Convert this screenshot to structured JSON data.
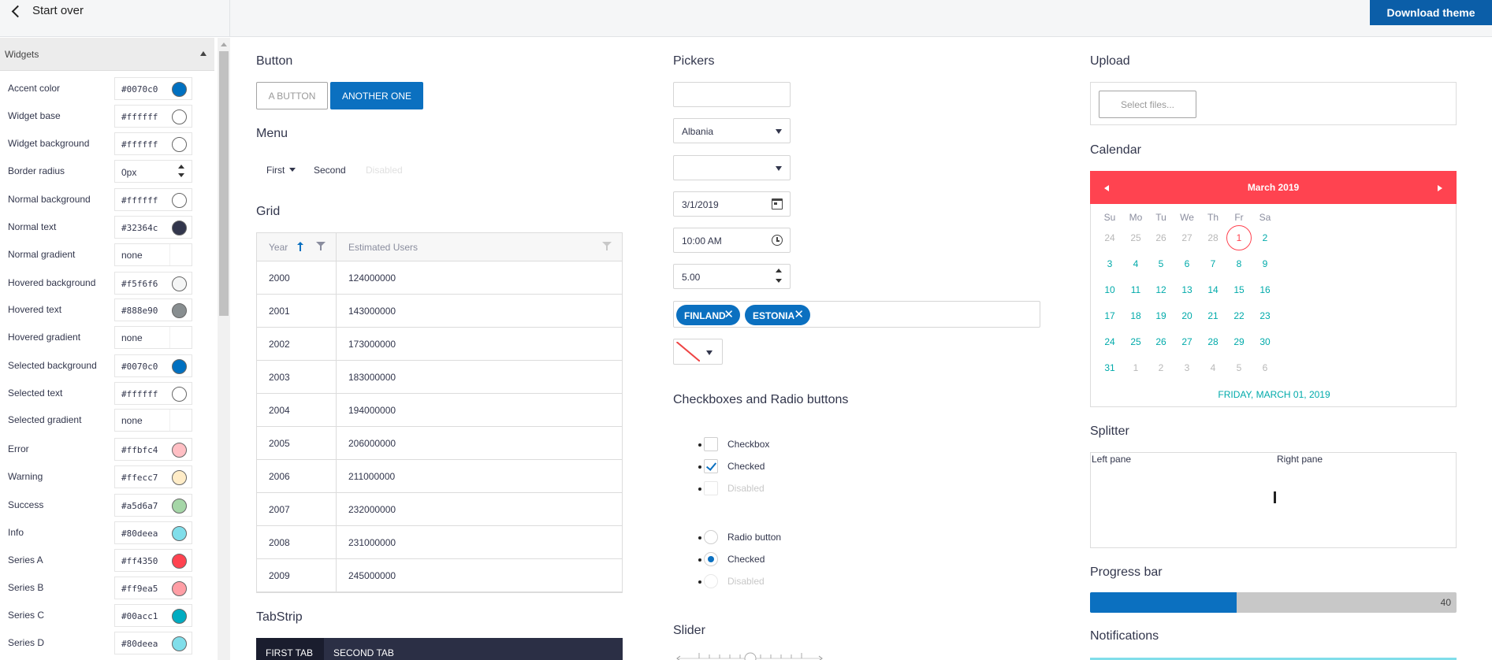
{
  "topbar": {
    "start_over": "Start over",
    "download": "Download theme"
  },
  "sidebar": {
    "section": "Widgets",
    "items": [
      {
        "label": "Accent color",
        "value": "#0070c0",
        "swatch": "#0070c0"
      },
      {
        "label": "Widget base",
        "value": "#ffffff",
        "swatch": "#ffffff"
      },
      {
        "label": "Widget background",
        "value": "#ffffff",
        "swatch": "#ffffff"
      },
      {
        "label": "Border radius",
        "value": "0px",
        "type": "number"
      },
      {
        "label": "Normal background",
        "value": "#ffffff",
        "swatch": "#ffffff"
      },
      {
        "label": "Normal text",
        "value": "#32364c",
        "swatch": "#32364c"
      },
      {
        "label": "Normal gradient",
        "value": "none",
        "type": "text"
      },
      {
        "label": "Hovered background",
        "value": "#f5f6f6",
        "swatch": "#f5f6f6"
      },
      {
        "label": "Hovered text",
        "value": "#888e90",
        "swatch": "#888e90"
      },
      {
        "label": "Hovered gradient",
        "value": "none",
        "type": "text"
      },
      {
        "label": "Selected background",
        "value": "#0070c0",
        "swatch": "#0070c0"
      },
      {
        "label": "Selected text",
        "value": "#ffffff",
        "swatch": "#ffffff"
      },
      {
        "label": "Selected gradient",
        "value": "none",
        "type": "text"
      },
      {
        "label": "Error",
        "value": "#ffbfc4",
        "swatch": "#ffbfc4"
      },
      {
        "label": "Warning",
        "value": "#ffecc7",
        "swatch": "#ffecc7"
      },
      {
        "label": "Success",
        "value": "#a5d6a7",
        "swatch": "#a5d6a7"
      },
      {
        "label": "Info",
        "value": "#80deea",
        "swatch": "#80deea"
      },
      {
        "label": "Series A",
        "value": "#ff4350",
        "swatch": "#ff4350"
      },
      {
        "label": "Series B",
        "value": "#ff9ea5",
        "swatch": "#ff9ea5"
      },
      {
        "label": "Series C",
        "value": "#00acc1",
        "swatch": "#00acc1"
      },
      {
        "label": "Series D",
        "value": "#80deea",
        "swatch": "#80deea"
      }
    ]
  },
  "button": {
    "title": "Button",
    "a": "A button",
    "b": "Another one"
  },
  "menu": {
    "title": "Menu",
    "first": "First",
    "second": "Second",
    "disabled": "Disabled"
  },
  "grid": {
    "title": "Grid",
    "columns": [
      "Year",
      "Estimated Users"
    ],
    "rows": [
      [
        "2000",
        "124000000"
      ],
      [
        "2001",
        "143000000"
      ],
      [
        "2002",
        "173000000"
      ],
      [
        "2003",
        "183000000"
      ],
      [
        "2004",
        "194000000"
      ],
      [
        "2005",
        "206000000"
      ],
      [
        "2006",
        "211000000"
      ],
      [
        "2007",
        "232000000"
      ],
      [
        "2008",
        "231000000"
      ],
      [
        "2009",
        "245000000"
      ]
    ]
  },
  "tabstrip": {
    "title": "TabStrip",
    "tabs": [
      "First tab",
      "Second tab"
    ]
  },
  "pickers": {
    "title": "Pickers",
    "autocomplete": "",
    "dropdown": "Albania",
    "combobox": "",
    "date": "3/1/2019",
    "time": "10:00 AM",
    "number": "5.00",
    "tags": [
      "Finland",
      "Estonia"
    ],
    "tag_remove": "✕"
  },
  "checks": {
    "title": "Checkboxes and Radio buttons",
    "checkbox": "Checkbox",
    "checked": "Checked",
    "disabled": "Disabled",
    "radio": "Radio button",
    "radio_checked": "Checked",
    "radio_disabled": "Disabled"
  },
  "slider": {
    "title": "Slider"
  },
  "upload": {
    "title": "Upload",
    "button": "Select files..."
  },
  "calendar": {
    "title": "Calendar",
    "month": "March 2019",
    "dow": [
      "Su",
      "Mo",
      "Tu",
      "We",
      "Th",
      "Fr",
      "Sa"
    ],
    "weeks": [
      [
        "24",
        "25",
        "26",
        "27",
        "28",
        "1",
        "2"
      ],
      [
        "3",
        "4",
        "5",
        "6",
        "7",
        "8",
        "9"
      ],
      [
        "10",
        "11",
        "12",
        "13",
        "14",
        "15",
        "16"
      ],
      [
        "17",
        "18",
        "19",
        "20",
        "21",
        "22",
        "23"
      ],
      [
        "24",
        "25",
        "26",
        "27",
        "28",
        "29",
        "30"
      ],
      [
        "31",
        "1",
        "2",
        "3",
        "4",
        "5",
        "6"
      ]
    ],
    "footer": "Friday, March 01, 2019"
  },
  "splitter": {
    "title": "Splitter",
    "left": "Left pane",
    "right": "Right pane"
  },
  "progress": {
    "title": "Progress bar",
    "value": 40,
    "max": 100,
    "label": "40"
  },
  "notifications": {
    "title": "Notifications"
  },
  "colors": {
    "accent": "#0070c0",
    "calendar_header": "#ff4350",
    "info": "#80deea"
  }
}
